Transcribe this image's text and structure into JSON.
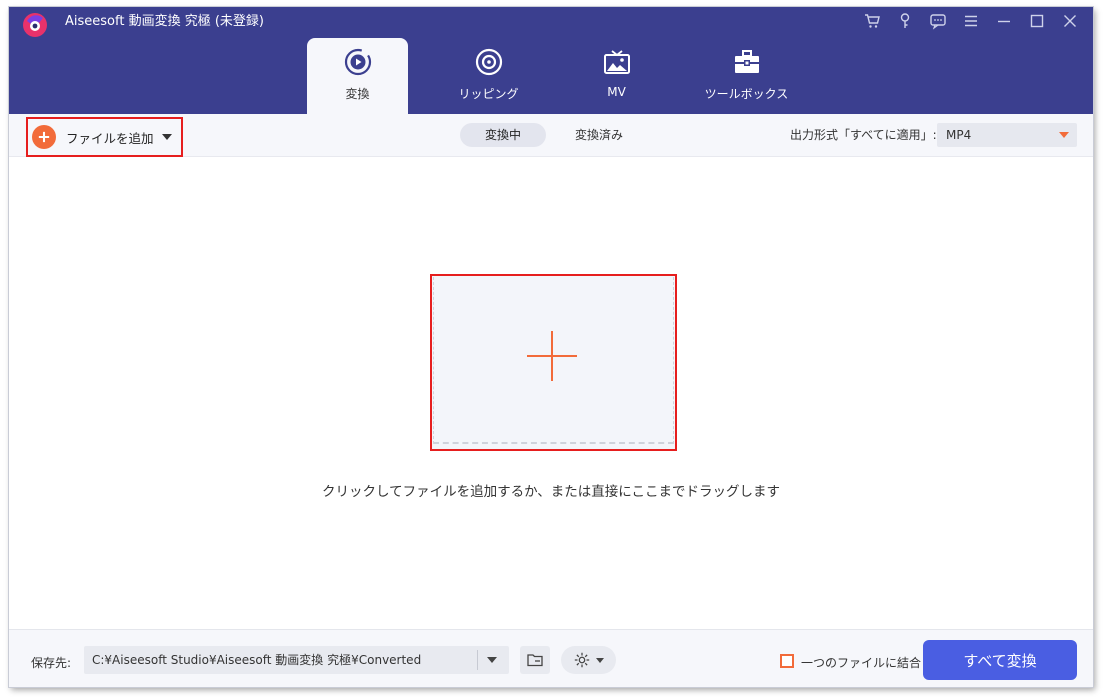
{
  "app": {
    "title": "Aiseesoft 動画変換 究極 (未登録)"
  },
  "window_controls": [
    {
      "name": "cart-icon"
    },
    {
      "name": "key-icon"
    },
    {
      "name": "feedback-icon"
    },
    {
      "name": "menu-icon"
    },
    {
      "name": "minimize-icon"
    },
    {
      "name": "maximize-icon"
    },
    {
      "name": "close-icon"
    }
  ],
  "tabs": [
    {
      "label": "変換",
      "icon": "convert-icon",
      "active": true
    },
    {
      "label": "リッピング",
      "icon": "ripper-icon",
      "active": false
    },
    {
      "label": "MV",
      "icon": "mv-icon",
      "active": false
    },
    {
      "label": "ツールボックス",
      "icon": "toolbox-icon",
      "active": false
    }
  ],
  "toolbar": {
    "add_file_label": "ファイルを追加",
    "segments": [
      {
        "label": "変換中",
        "selected": true
      },
      {
        "label": "変換済み",
        "selected": false
      }
    ],
    "output_format_label": "出力形式「すべてに適用」:",
    "output_format_value": "MP4"
  },
  "main": {
    "drop_hint": "クリックしてファイルを追加するか、または直接にここまでドラッグします"
  },
  "footer": {
    "save_label": "保存先:",
    "save_path": "C:¥Aiseesoft Studio¥Aiseesoft 動画変換 究極¥Converted",
    "merge_label": "一つのファイルに結合",
    "merge_checked": false,
    "convert_all_label": "すべて変換"
  },
  "colors": {
    "header": "#3b3f8f",
    "accent_orange": "#f26b3a",
    "convert_button": "#4a5ee2",
    "highlight_red": "#e61e1e"
  }
}
